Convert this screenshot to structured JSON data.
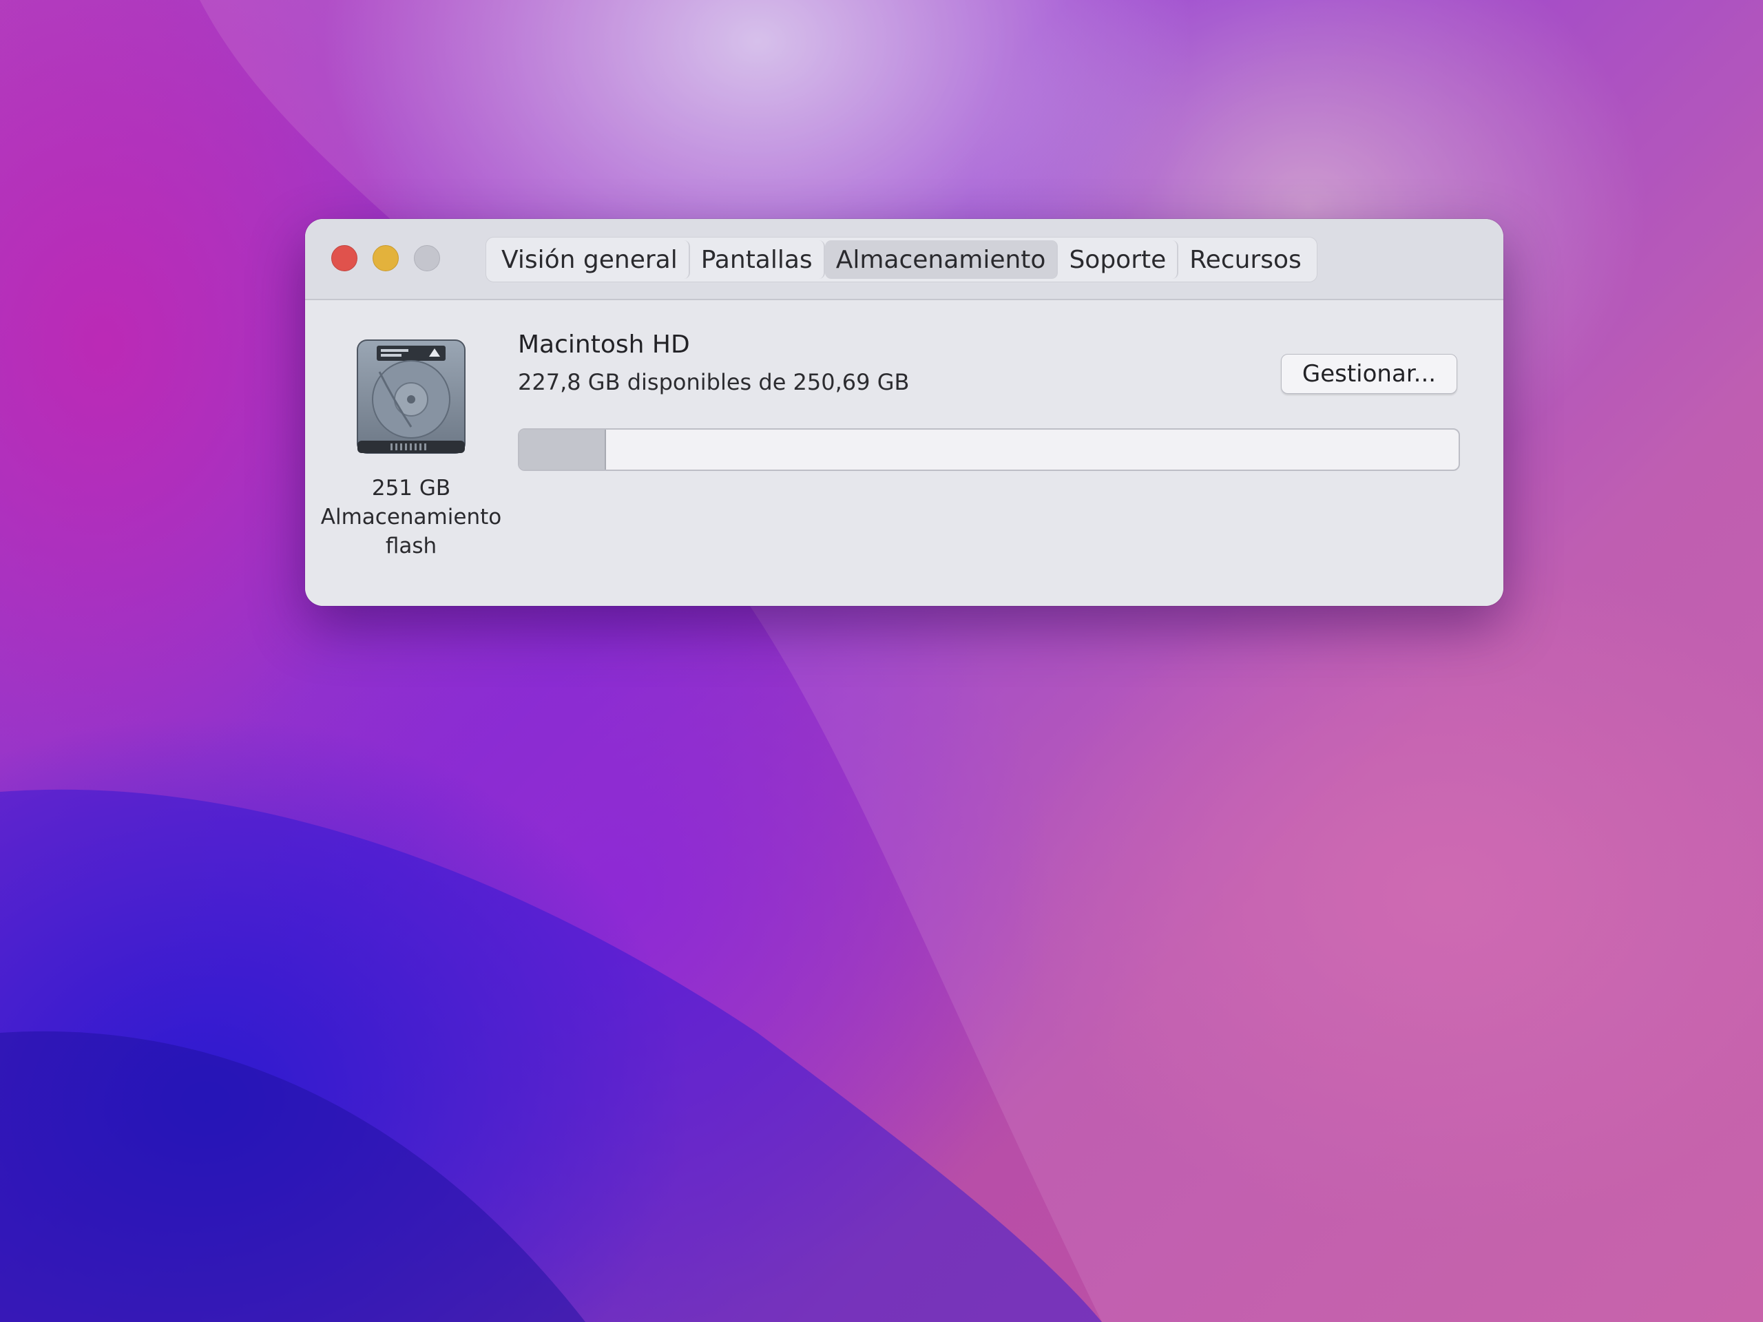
{
  "window": {
    "tabs": [
      {
        "label": "Visión general",
        "selected": false
      },
      {
        "label": "Pantallas",
        "selected": false
      },
      {
        "label": "Almacenamiento",
        "selected": true
      },
      {
        "label": "Soporte",
        "selected": false
      },
      {
        "label": "Recursos",
        "selected": false
      }
    ]
  },
  "drive": {
    "icon": "hard-drive-icon",
    "caption_line1": "251 GB",
    "caption_line2": "Almacenamiento",
    "caption_line3": "flash"
  },
  "volume": {
    "name": "Macintosh HD",
    "space_text": "227,8 GB disponibles de 250,69 GB",
    "used_fraction": 0.091,
    "manage_label": "Gestionar..."
  },
  "colors": {
    "close": "#e0524c",
    "minimize": "#e3b23c",
    "zoom": "#c4c5cd",
    "used_bar": "#c3c5cc"
  }
}
